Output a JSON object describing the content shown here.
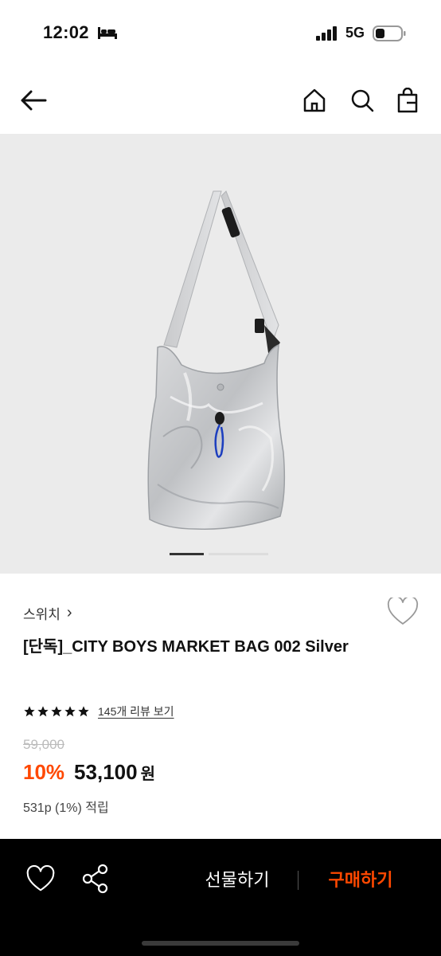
{
  "status_bar": {
    "time": "12:02",
    "network": "5G",
    "icons": [
      "bed-icon",
      "signal-icon",
      "battery-icon"
    ]
  },
  "nav": {
    "icons": [
      "back-arrow-icon",
      "home-icon",
      "search-icon",
      "shopping-bag-icon"
    ]
  },
  "gallery": {
    "image": "silver-market-bag",
    "slide_count": 2,
    "active_slide": 1
  },
  "product": {
    "brand": "스위치",
    "brand_chevron": "›",
    "title": "[단독]_CITY BOYS MARKET BAG 002 Silver",
    "rating": 5,
    "review_link": "145개 리뷰 보기",
    "original_price": "59,000",
    "discount": "10%",
    "price": "53,100",
    "currency": "원",
    "points": "531p (1%) 적립"
  },
  "bottom_bar": {
    "gift_label": "선물하기",
    "buy_label": "구매하기",
    "icons": [
      "heart-icon",
      "share-icon"
    ]
  },
  "colors": {
    "accent": "#ff4800",
    "gallery_bg": "#ebebeb",
    "bottom_bg": "#000000"
  }
}
